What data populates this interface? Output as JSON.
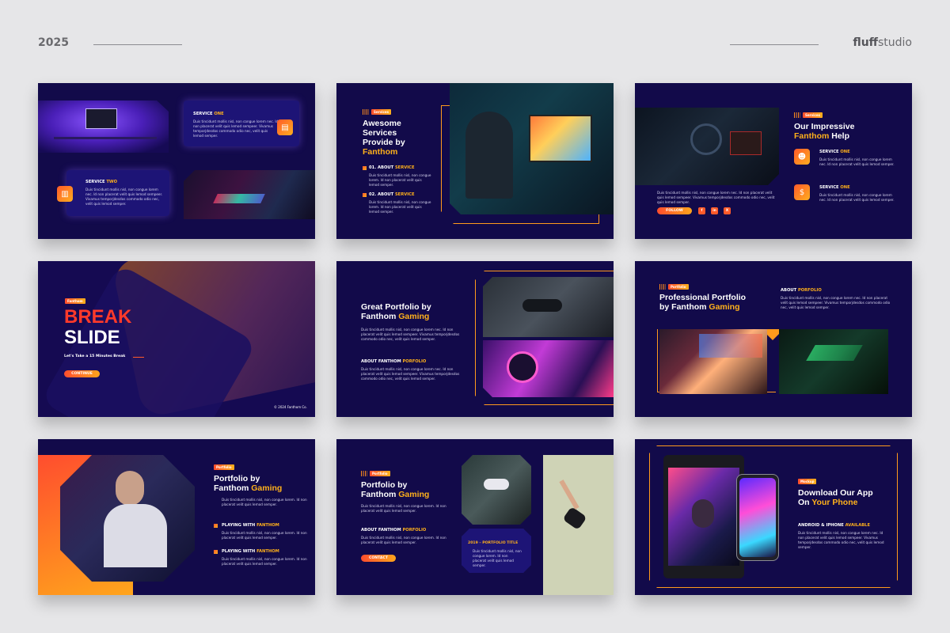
{
  "header": {
    "year": "2025",
    "brand_bold": "fluff",
    "brand_rest": "studio"
  },
  "lorem": {
    "short": "Duis tincidunt mollis nisl, non congue lorem nec. Id non placerat velit quis lemod sempeer. Vivamus temporjdesdos commodo odio nec, velit quis lemod semper.",
    "tiny": "Duis tincidunt mollis nisl, non congue lorem nec. Id non placerat velit quis lemod semper.",
    "mini": "Duis tincidunt mollis nisl, non congue lorem. Id non placerat velit quis lemod semper."
  },
  "s1": {
    "service_one_a": "SERVICE ",
    "service_one_b": "ONE",
    "service_two_a": "SERVICE ",
    "service_two_b": "TWO"
  },
  "s2": {
    "badge": "Services",
    "t1": "Awesome",
    "t2": "Services",
    "t3": "Provide by",
    "t4": "Fanthom",
    "a1_a": "01. ABOUT ",
    "a1_b": "SERVICE",
    "a2_a": "02. ABOUT ",
    "a2_b": "SERVICE"
  },
  "s3": {
    "badge": "Services",
    "t1": "Our Impressive",
    "t2a": "Fanthom",
    "t2b": " Help",
    "one_a": "SERVICE ",
    "one_b": "ONE",
    "two_a": "SERVICE ",
    "two_b": "ONE",
    "follow": "FOLLOW",
    "social": [
      "f",
      "in",
      "X"
    ]
  },
  "s4": {
    "badge": "Fanthom",
    "t1": "BREAK",
    "t2": "SLIDE",
    "sub": "Let's Take a 15 Minutes Break",
    "btn": "CONTINUE",
    "copy": "© 2024 Fanthom Co."
  },
  "s5": {
    "t1": "Great Portfolio by",
    "t2a": "Fanthom ",
    "t2b": "Gaming",
    "h_a": "ABOUT FANTHOM ",
    "h_b": "PORFOLIO"
  },
  "s6": {
    "badge": "Portfolio",
    "t1": "Professional Portfolio",
    "t2a": "by Fanthom ",
    "t2b": "Gaming",
    "h_a": "ABOUT ",
    "h_b": "PORFOLIO"
  },
  "s7": {
    "badge": "Portfolio",
    "t1": "Portfolio by",
    "t2a": "Fanthom ",
    "t2b": "Gaming",
    "p1_a": "PLAYING WITH ",
    "p1_b": "FANTHOM",
    "p2_a": "PLAYING WITH ",
    "p2_b": "FANTHOM"
  },
  "s8": {
    "badge": "Portfolio",
    "t1": "Portfolio by",
    "t2a": "Fanthom ",
    "t2b": "Gaming",
    "h_a": "ABOUT FANTHOM ",
    "h_b": "PORFOLIO",
    "btn": "CONTACT",
    "card_title": "2019 – PORTFOLIO TITLE"
  },
  "s9": {
    "badge": "Mockup",
    "t1": "Download Our App",
    "t2a": "On ",
    "t2b": "Your Phone",
    "h_a": "ANDROID & IPHONE ",
    "h_b": "AVAILABLE"
  },
  "colors": {
    "slide_bg": "#120a4a",
    "accent_orange": "#ff8a1c",
    "accent_yellow": "#ffb11b",
    "accent_red": "#ff3a2a"
  }
}
